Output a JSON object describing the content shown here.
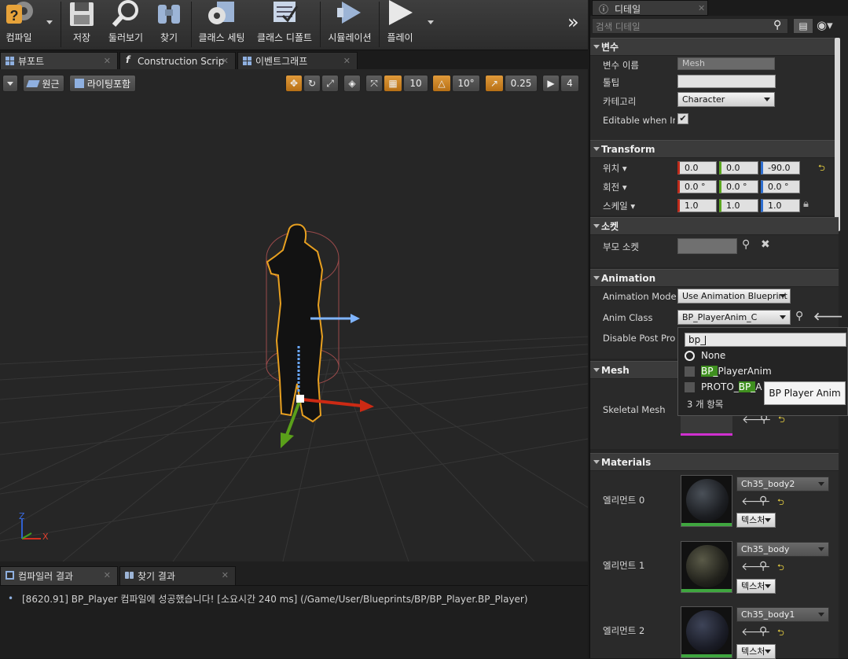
{
  "toolbar": {
    "items": [
      "컴파일",
      "저장",
      "둘러보기",
      "찾기",
      "클래스 세팅",
      "클래스 디폴트",
      "시뮬레이션",
      "플레이"
    ],
    "overflow": "»"
  },
  "tabs": [
    "뷰포트",
    "Construction Scrip",
    "이벤트그래프"
  ],
  "viewport": {
    "perspective": "원근",
    "lighting": "라이팅포함",
    "grid_snap": "10",
    "rot_snap": "10°",
    "scale_snap": "0.25",
    "cam_speed": "4",
    "axis_x": "X",
    "axis_z": "Z"
  },
  "bottom_tabs": [
    "컴파일러 결과",
    "찾기 결과"
  ],
  "log": {
    "bullet": "•",
    "message": "[8620.91] BP_Player 컴파일에 성공했습니다! [소요시간 240 ms] (/Game/User/Blueprints/BP/BP_Player.BP_Player)"
  },
  "details": {
    "title": "디테일",
    "search_placeholder": "검색 디테일",
    "variable_section": "변수",
    "variable_name_label": "변수 이름",
    "variable_name": "Mesh",
    "tooltip_label": "툴팁",
    "tooltip_value": "",
    "category_label": "카테고리",
    "category_value": "Character",
    "editable_label": "Editable when Inhe",
    "transform_section": "Transform",
    "location_label": "위치",
    "location": [
      "0.0",
      "0.0",
      "-90.0"
    ],
    "rotation_label": "회전",
    "rotation": [
      "0.0 °",
      "0.0 °",
      "0.0 °"
    ],
    "scale_label": "스케일",
    "scale": [
      "1.0",
      "1.0",
      "1.0"
    ],
    "socket_section": "소켓",
    "parent_socket_label": "부모 소켓",
    "parent_socket_value": "",
    "animation_section": "Animation",
    "anim_mode_label": "Animation Mode",
    "anim_mode_value": "Use Animation Blueprint",
    "anim_class_label": "Anim Class",
    "anim_class_value": "BP_PlayerAnim_C",
    "disable_post_label": "Disable Post Proc",
    "mesh_section": "Mesh",
    "skeletal_mesh_label": "Skeletal Mesh",
    "materials_section": "Materials",
    "materials": [
      {
        "label": "엘리먼트 0",
        "name": "Ch35_body2",
        "texture_btn": "텍스처"
      },
      {
        "label": "엘리먼트 1",
        "name": "Ch35_body",
        "texture_btn": "텍스처"
      },
      {
        "label": "엘리먼트 2",
        "name": "Ch35_body1",
        "texture_btn": "텍스처"
      }
    ]
  },
  "popup": {
    "search_value": "bp_",
    "none_item": "None",
    "item1_match": "BP_",
    "item1_rest": "PlayerAnim",
    "item2_prefix": "PROTO_",
    "item2_match": "BP_",
    "item2_rest": "A",
    "count": "3 개 항목",
    "tooltip": "BP Player Anim"
  }
}
